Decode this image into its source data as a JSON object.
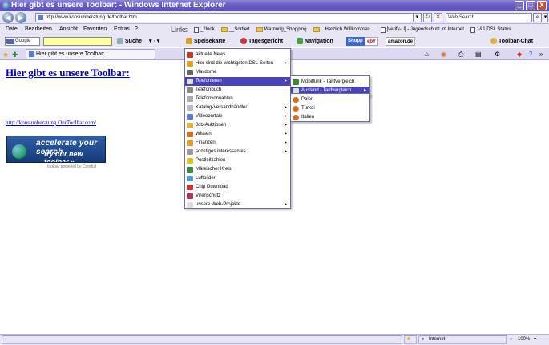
{
  "window": {
    "title": "Hier gibt es unsere Toolbar: - Windows Internet Explorer",
    "buttons": [
      "_",
      "□",
      "X"
    ]
  },
  "address": {
    "url": "http://www.konsumberatung.de/toolbar.htm",
    "search_placeholder": "Web Search"
  },
  "menu": {
    "items": [
      "Datei",
      "Bearbeiten",
      "Ansicht",
      "Favoriten",
      "Extras",
      "?"
    ]
  },
  "links": {
    "label": "Links",
    "items": [
      "_2look",
      "__Sortiert",
      "Warnung_Shopping",
      "...Herzlich Willkommen...",
      "[verify-U] - Jugendschutz im Internet",
      "1&1 DSL Status"
    ]
  },
  "toolbar": {
    "google_label": "Google",
    "suche": "Suche",
    "speisekarte": "Speisekarte",
    "tagesgericht": "Tagesgericht",
    "navigation": "Navigation",
    "shopping": "Shopp",
    "ebay": "ebY",
    "amazon": "amazon.de",
    "chat": "Toolbar-Chat"
  },
  "tab": {
    "title": "Hier gibt es unsere Toolbar:"
  },
  "page": {
    "heading": "Hier gibt es unsere Toolbar:",
    "link": "http://konsumberatung.OurToolbar.com/",
    "banner_line1": "accelerate your search",
    "banner_line2": "try our new toolbar »",
    "banner_sub": "toolbar powered by Conduit"
  },
  "dropdown": {
    "items": [
      "aktuelle News",
      "Hier sind die wichtigsten DSL-Seiten",
      "Maxdome",
      "Telefonieren",
      "Telefonbuch",
      "Telefonvorwahlen",
      "Katalog-Versandhändler",
      "Videoportale",
      "Job-Auktionen",
      "Wissen",
      "Finanzen",
      "sonstiges interessantes",
      "Postleitzahlen",
      "Märkischer Kreis",
      "Luftbilder",
      "Chip Download",
      "Virenschutz",
      "unsere Web-Projekte"
    ],
    "submenu1": [
      "Mobilfunk - Tarifvergleich",
      "Ausland - Tarifvergleich"
    ],
    "submenu2": [
      "Polen",
      "Türkei",
      "Italien"
    ]
  },
  "status": {
    "zone": "Internet",
    "zoom": "100%"
  },
  "colors": {
    "title_bar": "#6a5fc4",
    "highlight": "#4a42b8",
    "link": "#0000cc"
  }
}
